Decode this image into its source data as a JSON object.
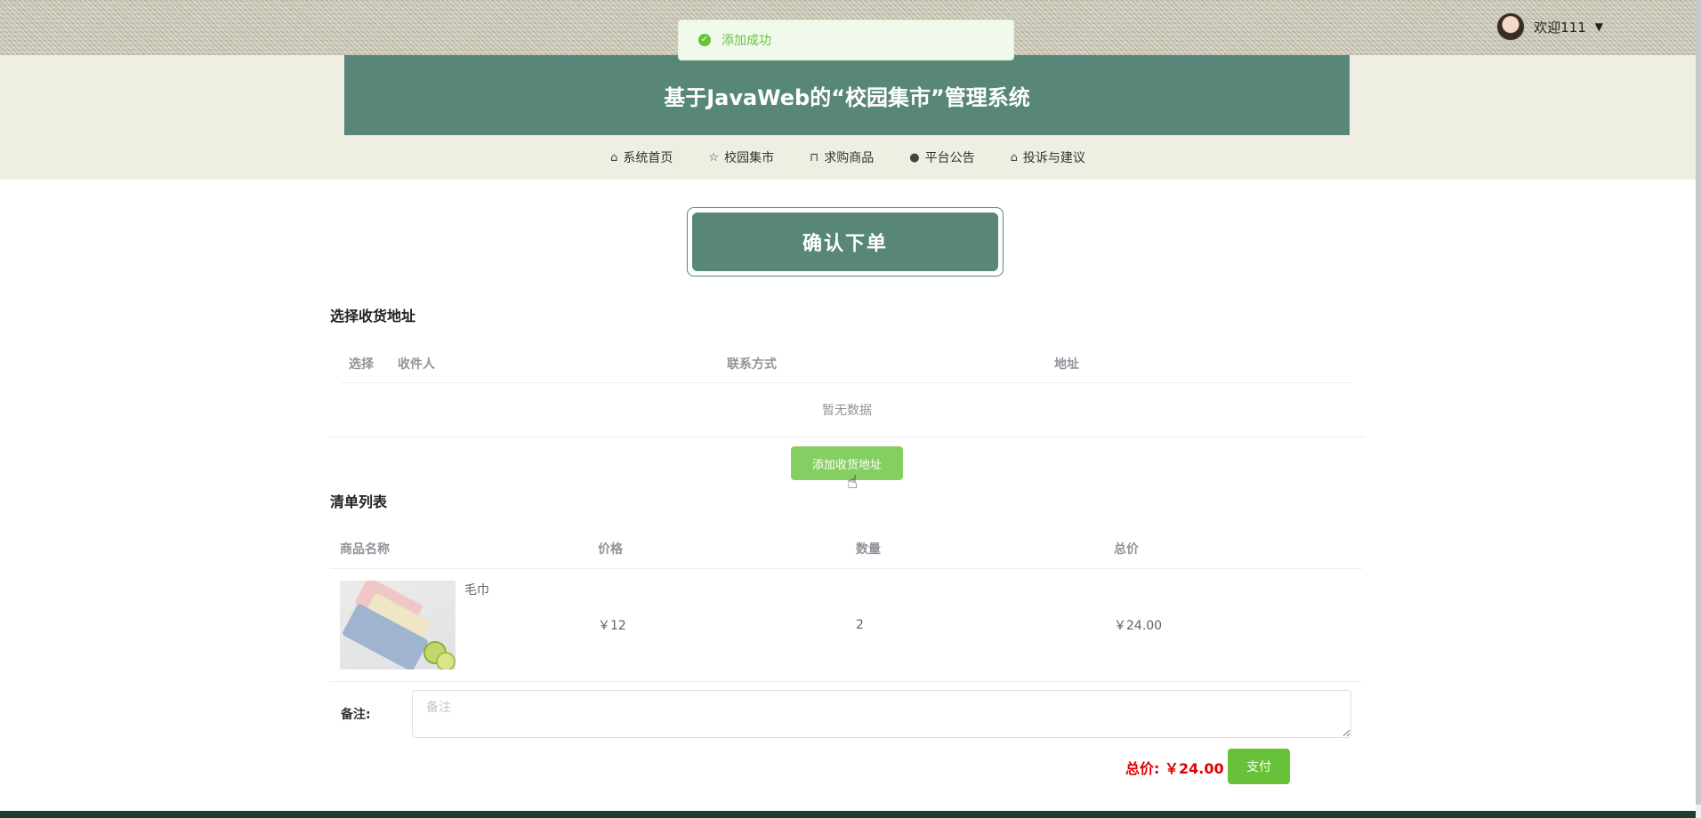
{
  "toast": {
    "message": "添加成功",
    "icon": "check-circle-icon",
    "color": "#67c23a"
  },
  "user": {
    "welcome": "欢迎111",
    "avatar_icon": "user-avatar"
  },
  "site": {
    "title": "基于JavaWeb的“校园集市”管理系统",
    "brand_color": "#58877a"
  },
  "nav": {
    "items": [
      {
        "label": "系统首页",
        "icon": "home-icon"
      },
      {
        "label": "校园集市",
        "icon": "star-icon"
      },
      {
        "label": "求购商品",
        "icon": "bag-icon"
      },
      {
        "label": "平台公告",
        "icon": "info-icon"
      },
      {
        "label": "投诉与建议",
        "icon": "home-icon"
      }
    ]
  },
  "page": {
    "heading": "确认下单"
  },
  "address": {
    "section_title": "选择收货地址",
    "columns": [
      "选择",
      "收件人",
      "联系方式",
      "地址"
    ],
    "empty_text": "暂无数据",
    "add_button": "添加收货地址"
  },
  "list": {
    "section_title": "清单列表",
    "columns": [
      "商品名称",
      "价格",
      "数量",
      "总价"
    ],
    "rows": [
      {
        "name": "毛巾",
        "price": "￥12",
        "quantity": "2",
        "total": "￥24.00"
      }
    ]
  },
  "remark": {
    "label": "备注:",
    "placeholder": "备注"
  },
  "summary": {
    "total_label": "总价:",
    "total_value": "￥24.00",
    "pay_button": "支付",
    "total_color": "#e00000"
  }
}
